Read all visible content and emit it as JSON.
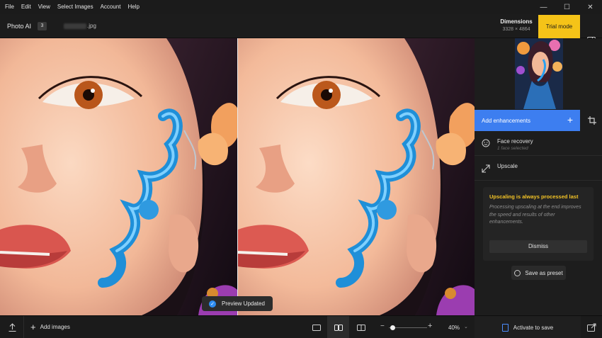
{
  "menu": [
    "File",
    "Edit",
    "View",
    "Select Images",
    "Account",
    "Help"
  ],
  "window_controls": {
    "minimize": "—",
    "maximize": "☐",
    "close": "✕"
  },
  "toolbar": {
    "app_name": "Photo AI",
    "image_count": "3",
    "filename_ext": ".jpg",
    "dimensions_label": "Dimensions",
    "dimensions_value": "3328 × 4864",
    "trial_label": "Trial mode"
  },
  "canvas": {
    "toast_text": "Preview Updated"
  },
  "panel": {
    "add_enhancements": "Add enhancements",
    "enhancements": [
      {
        "title": "Face recovery",
        "subtitle": "1 face selected",
        "icon": "face-icon"
      },
      {
        "title": "Upscale",
        "subtitle": "",
        "icon": "expand-icon"
      }
    ],
    "notice": {
      "title": "Upscaling is always processed last",
      "body": "Processing upscaling at the end improves the speed and results of other enhancements.",
      "dismiss": "Dismiss"
    },
    "save_preset": "Save as preset"
  },
  "bottom": {
    "add_images": "Add images",
    "zoom_value": "40%",
    "zoom_fraction": 0.1,
    "activate": "Activate to save"
  },
  "colors": {
    "accent": "#3d7ef0",
    "trial": "#f5c318",
    "notice_title": "#f3c326"
  }
}
